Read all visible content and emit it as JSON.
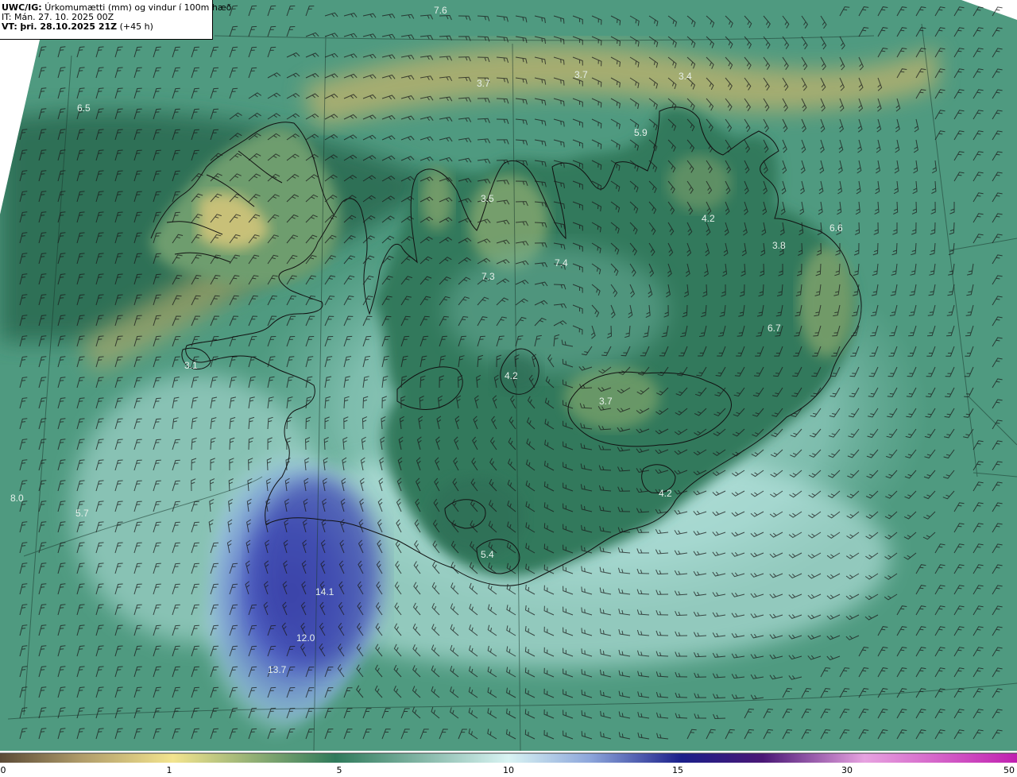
{
  "header": {
    "model_tag": "UWC/IG:",
    "description": "Úrkomumætti (mm) og vindur í 100m hæð",
    "init_time": "IT: Mán. 27. 10. 2025 00Z",
    "valid_prefix": "VT:",
    "valid_time": "þri. 28.10.2025 21Z",
    "lead_time": "(+45 h)"
  },
  "value_labels": [
    {
      "text": "7.6"
    },
    {
      "text": "3.7"
    },
    {
      "text": "3.7"
    },
    {
      "text": "3.4"
    },
    {
      "text": "6.5"
    },
    {
      "text": "5.9"
    },
    {
      "text": "3.5"
    },
    {
      "text": "4.2"
    },
    {
      "text": "6.6"
    },
    {
      "text": "3.8"
    },
    {
      "text": "7.4"
    },
    {
      "text": "7.3"
    },
    {
      "text": "6.7"
    },
    {
      "text": "3.1"
    },
    {
      "text": "4.2"
    },
    {
      "text": "3.7"
    },
    {
      "text": "4.2"
    },
    {
      "text": "8.0"
    },
    {
      "text": "5.7"
    },
    {
      "text": "5.4"
    },
    {
      "text": "14.1"
    },
    {
      "text": "12.0"
    },
    {
      "text": "13.7"
    }
  ],
  "colorbar": {
    "ticks": [
      "0",
      "1",
      "5",
      "10",
      "15",
      "30",
      "50"
    ],
    "colors": [
      "#6b5a44",
      "#c9b47a",
      "#f0e08a",
      "#3e8f6a",
      "#cfeff0",
      "#2b2f9a",
      "#3a0b6a",
      "#e9a7e2",
      "#c23cb7"
    ]
  },
  "legend_colors": {
    "sea_low": "#3e7d66",
    "sea_mid": "#5ea38a",
    "yellow_band": "#b9b773",
    "light_cyan": "#bfe9e6",
    "heavy_blue": "#4a55b8",
    "coast_line": "#111111"
  }
}
